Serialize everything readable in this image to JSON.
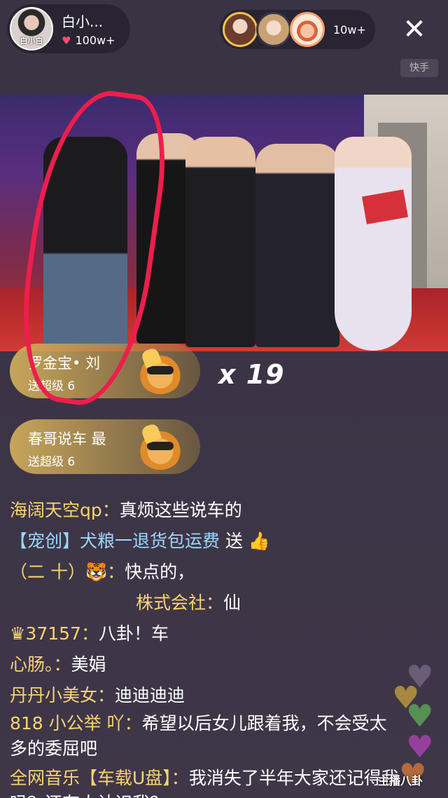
{
  "header": {
    "anchor_name": "白小...",
    "anchor_avatar_tag": "白小白",
    "anchor_likes": "100w+",
    "viewer_count": "10w+",
    "platform_label": "快手"
  },
  "gifts": [
    {
      "sender": "罗金宝• 刘",
      "description": "送超级 6"
    },
    {
      "sender": "春哥说车 最",
      "description": "送超级 6"
    }
  ],
  "combo": "x 19",
  "chat": [
    {
      "user": "海阔天空qp：",
      "text": "真烦这些说车的"
    },
    {
      "user": "【宠创】犬粮一退货包运费",
      "text": " 送 👍"
    },
    {
      "user": "（二 十）🐯：",
      "text": "快点的，"
    },
    {
      "user": "株式会社：",
      "text": "仙"
    },
    {
      "user": "♛37157：",
      "text": "八卦！车"
    },
    {
      "user": "心肠。：",
      "text": "美娟"
    },
    {
      "user": "丹丹小美女：",
      "text": "迪迪迪迪"
    },
    {
      "user": "818 小公举 吖：",
      "text": "希望以后女儿跟着我，不会受太多的委屈吧"
    },
    {
      "user": "全网音乐【车载U盘】：",
      "text": "我消失了半年大家还记得我吗？还有人认识我？"
    }
  ],
  "watermark": "主播八卦"
}
